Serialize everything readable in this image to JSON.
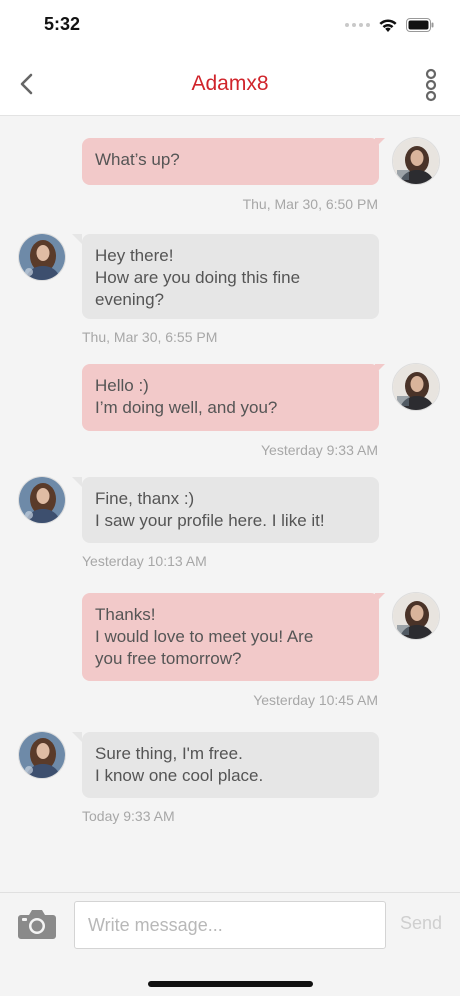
{
  "status_bar": {
    "time": "5:32"
  },
  "header": {
    "title": "Adamx8",
    "title_color": "#d0242b"
  },
  "messages": [
    {
      "direction": "outgoing",
      "lines": [
        "What’s up?"
      ],
      "timestamp": "Thu, Mar 30, 6:50 PM"
    },
    {
      "direction": "incoming",
      "lines": [
        "Hey there!",
        "How are you doing this fine",
        "evening?"
      ],
      "timestamp": "Thu, Mar 30, 6:55 PM"
    },
    {
      "direction": "outgoing",
      "lines": [
        "Hello :)",
        "I’m doing well, and you?"
      ],
      "timestamp": "Yesterday 9:33 AM"
    },
    {
      "direction": "incoming",
      "lines": [
        "Fine, thanx :)",
        "I saw your profile here. I like it!"
      ],
      "timestamp": "Yesterday 10:13 AM"
    },
    {
      "direction": "outgoing",
      "lines": [
        "Thanks!",
        "I would love to meet you! Are",
        "you free tomorrow?"
      ],
      "timestamp": "Yesterday 10:45 AM"
    },
    {
      "direction": "incoming",
      "lines": [
        "Sure thing, I'm free.",
        "I know one cool place."
      ],
      "timestamp": "Today 9:33 AM"
    }
  ],
  "composer": {
    "placeholder": "Write message...",
    "value": "",
    "send_label": "Send"
  },
  "icons": {
    "back": "chevron-left-icon",
    "more": "vertical-dots-icon",
    "camera": "camera-icon",
    "wifi": "wifi-icon",
    "battery": "battery-icon"
  },
  "colors": {
    "outgoing_bubble": "#f2c9c9",
    "incoming_bubble": "#e6e6e6",
    "background": "#f4f4f4",
    "timestamp": "#a7a7a7"
  }
}
